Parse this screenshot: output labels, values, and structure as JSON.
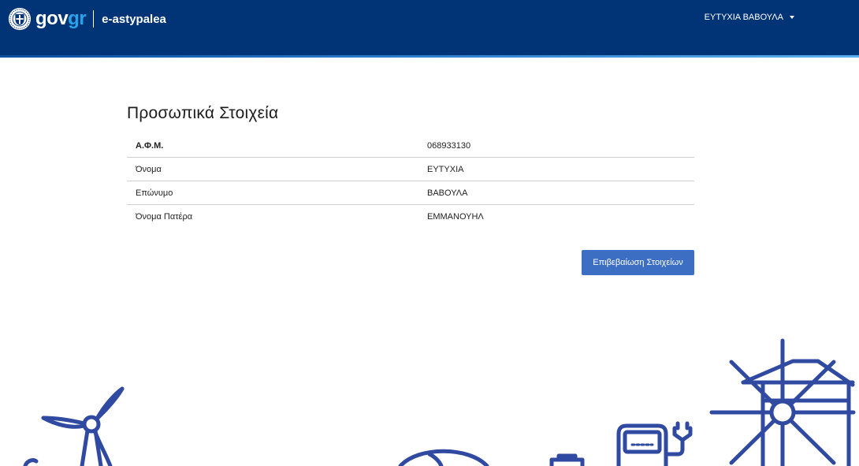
{
  "header": {
    "logo": {
      "gov": "gov",
      "gr": "gr"
    },
    "site_name": "e-astypalea",
    "user_name": "ΕΥΤΥΧΙΑ ΒΑΒΟΥΛΑ"
  },
  "main": {
    "title": "Προσωπικά Στοιχεία",
    "rows": [
      {
        "label": "Α.Φ.Μ.",
        "value": "068933130"
      },
      {
        "label": "Όνομα",
        "value": "ΕΥΤΥΧΙΑ"
      },
      {
        "label": "Επώνυμο",
        "value": "ΒΑΒΟΥΛΑ"
      },
      {
        "label": "Όνομα Πατέρα",
        "value": "ΕΜΜΑΝΟΥΗΛ"
      }
    ],
    "confirm_label": "Επιβεβαίωση Στοιχείων"
  },
  "colors": {
    "header_bg": "#003476",
    "accent_blue": "#27a4ea",
    "button_bg": "#3c6fc4",
    "illustration_stroke": "#2f4aa0"
  },
  "icons": [
    "greek-emblem-icon",
    "chevron-down-icon",
    "wind-turbine-icon",
    "globe-icon",
    "ev-charger-icon",
    "windmill-icon"
  ]
}
